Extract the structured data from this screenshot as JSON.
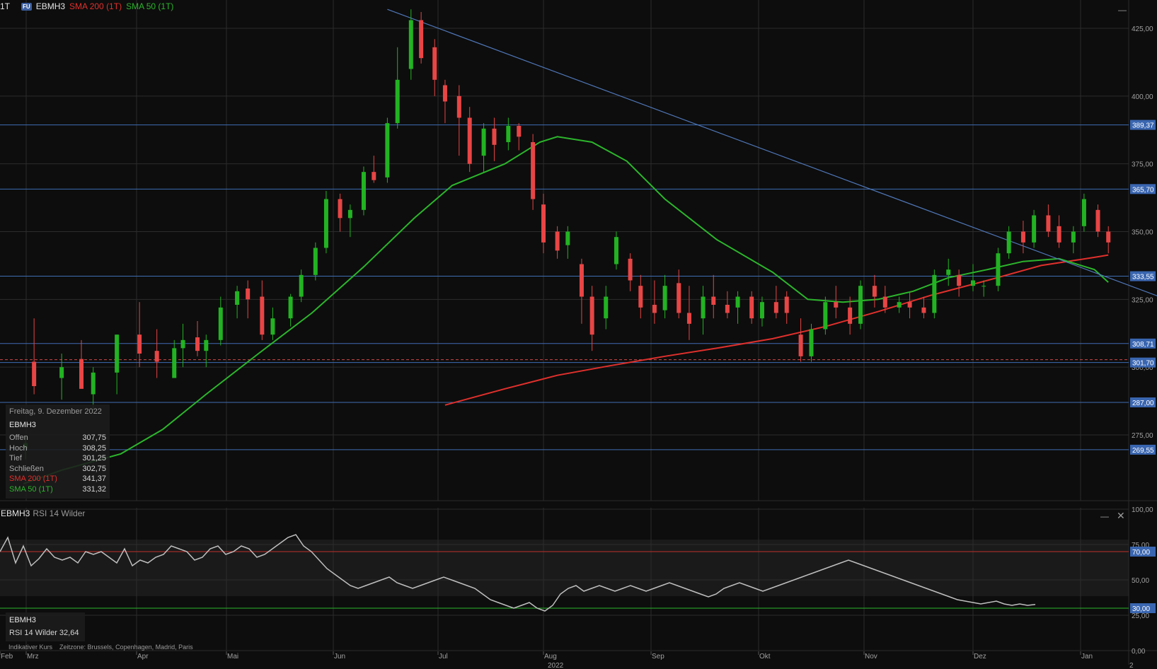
{
  "header": {
    "timeframe": "1T",
    "badge": "FU",
    "symbol": "EBMH3",
    "sma200_label": "SMA 200 (1T)",
    "sma50_label": "SMA 50 (1T)"
  },
  "colors": {
    "up": "#22b322",
    "down": "#e84545",
    "sma200": "#e0302c",
    "sma50": "#2cb52c",
    "trendline": "#4f77b8",
    "hline": "#3f6db3",
    "rsi": "#bfbfbf",
    "rsi_upper": "#c0302c",
    "rsi_lower": "#2cb52c"
  },
  "info_box": {
    "date": "Freitag, 9. Dezember 2022",
    "symbol": "EBMH3",
    "rows": [
      {
        "label": "Offen",
        "value": "307,75"
      },
      {
        "label": "Hoch",
        "value": "308,25"
      },
      {
        "label": "Tief",
        "value": "301,25"
      },
      {
        "label": "Schließen",
        "value": "302,75"
      },
      {
        "label": "SMA 200 (1T)",
        "value": "341,37"
      },
      {
        "label": "SMA 50 (1T)",
        "value": "331,32"
      }
    ]
  },
  "rsi_panel": {
    "symbol": "EBMH3",
    "name": "RSI 14 Wilder",
    "info_symbol": "EBMH3",
    "info_value": "RSI 14 Wilder 32,64"
  },
  "footer": {
    "note": "Indikativer Kurs",
    "timezone": "Zeitzone: Brussels, Copenhagen, Madrid, Paris"
  },
  "chart_data": [
    {
      "type": "candlestick",
      "price_axis": {
        "ylim": [
          255.0,
          432.0
        ],
        "ticks": [
          "425,00",
          "400,00",
          "375,00",
          "350,00",
          "325,00",
          "300,00",
          "275,00"
        ],
        "tick_values": [
          425,
          400,
          375,
          350,
          325,
          300,
          275
        ]
      },
      "x_axis": {
        "labels": [
          "Feb",
          "Mrz",
          "Apr",
          "Mai",
          "Jun",
          "Jul",
          "Aug",
          "Sep",
          "Okt",
          "Nov",
          "Dez",
          "Jan"
        ],
        "year_label": "2022",
        "year_label_right": "2"
      },
      "horizontal_levels": [
        {
          "value": 389.37,
          "label": "389,37"
        },
        {
          "value": 365.7,
          "label": "365,70"
        },
        {
          "value": 333.55,
          "label": "333,55"
        },
        {
          "value": 308.71,
          "label": "308,71"
        },
        {
          "value": 301.7,
          "label": "301,70"
        },
        {
          "value": 287.0,
          "label": "287,00"
        },
        {
          "value": 269.55,
          "label": "269,55"
        }
      ],
      "current_price_line": 302.75,
      "trendline": {
        "from": {
          "x": "2022-05-17",
          "y": 432.0
        },
        "to": {
          "x": "2022-12-30",
          "y": 323.0
        }
      },
      "sma200": {
        "label": "SMA 200 (1T)",
        "points": [
          {
            "x": "2022-06-03",
            "y": 286.0
          },
          {
            "x": "2022-06-20",
            "y": 292.0
          },
          {
            "x": "2022-07-05",
            "y": 297.0
          },
          {
            "x": "2022-07-20",
            "y": 300.5
          },
          {
            "x": "2022-08-05",
            "y": 304.0
          },
          {
            "x": "2022-08-20",
            "y": 307.0
          },
          {
            "x": "2022-09-05",
            "y": 310.5
          },
          {
            "x": "2022-09-20",
            "y": 315.0
          },
          {
            "x": "2022-10-05",
            "y": 320.5
          },
          {
            "x": "2022-10-20",
            "y": 326.5
          },
          {
            "x": "2022-11-05",
            "y": 332.0
          },
          {
            "x": "2022-11-20",
            "y": 337.5
          },
          {
            "x": "2022-12-05",
            "y": 340.5
          },
          {
            "x": "2022-12-09",
            "y": 341.37
          }
        ]
      },
      "sma50": {
        "label": "SMA 50 (1T)",
        "points": [
          {
            "x": "2022-01-28",
            "y": 257.0
          },
          {
            "x": "2022-02-10",
            "y": 262.0
          },
          {
            "x": "2022-02-25",
            "y": 268.0
          },
          {
            "x": "2022-03-10",
            "y": 277.0
          },
          {
            "x": "2022-03-25",
            "y": 290.0
          },
          {
            "x": "2022-04-10",
            "y": 305.0
          },
          {
            "x": "2022-04-25",
            "y": 320.0
          },
          {
            "x": "2022-05-10",
            "y": 337.0
          },
          {
            "x": "2022-05-25",
            "y": 355.0
          },
          {
            "x": "2022-06-05",
            "y": 367.0
          },
          {
            "x": "2022-06-20",
            "y": 375.0
          },
          {
            "x": "2022-06-30",
            "y": 383.0
          },
          {
            "x": "2022-07-05",
            "y": 385.0
          },
          {
            "x": "2022-07-15",
            "y": 383.0
          },
          {
            "x": "2022-07-25",
            "y": 376.0
          },
          {
            "x": "2022-08-05",
            "y": 362.0
          },
          {
            "x": "2022-08-20",
            "y": 347.0
          },
          {
            "x": "2022-09-05",
            "y": 335.0
          },
          {
            "x": "2022-09-15",
            "y": 325.0
          },
          {
            "x": "2022-09-25",
            "y": 324.0
          },
          {
            "x": "2022-10-05",
            "y": 325.0
          },
          {
            "x": "2022-10-15",
            "y": 328.0
          },
          {
            "x": "2022-10-25",
            "y": 333.0
          },
          {
            "x": "2022-11-05",
            "y": 336.0
          },
          {
            "x": "2022-11-15",
            "y": 339.0
          },
          {
            "x": "2022-11-25",
            "y": 340.0
          },
          {
            "x": "2022-12-05",
            "y": 336.0
          },
          {
            "x": "2022-12-09",
            "y": 331.32
          }
        ]
      },
      "candles": [
        {
          "x": "2022-01-31",
          "o": 270,
          "h": 275,
          "l": 266,
          "c": 272
        },
        {
          "x": "2022-02-03",
          "o": 302,
          "h": 318,
          "l": 290,
          "c": 293
        },
        {
          "x": "2022-02-10",
          "o": 296,
          "h": 305,
          "l": 288,
          "c": 300
        },
        {
          "x": "2022-02-15",
          "o": 303,
          "h": 310,
          "l": 296,
          "c": 292
        },
        {
          "x": "2022-02-18",
          "o": 290,
          "h": 300,
          "l": 284,
          "c": 298
        },
        {
          "x": "2022-02-24",
          "o": 298,
          "h": 312,
          "l": 290,
          "c": 312
        },
        {
          "x": "2022-03-02",
          "o": 312,
          "h": 324,
          "l": 300,
          "c": 305
        },
        {
          "x": "2022-03-08",
          "o": 306,
          "h": 314,
          "l": 296,
          "c": 302
        },
        {
          "x": "2022-03-14",
          "o": 296,
          "h": 310,
          "l": 296,
          "c": 307
        },
        {
          "x": "2022-03-17",
          "o": 307,
          "h": 316,
          "l": 300,
          "c": 310
        },
        {
          "x": "2022-03-22",
          "o": 311,
          "h": 317,
          "l": 304,
          "c": 306
        },
        {
          "x": "2022-03-25",
          "o": 306,
          "h": 312,
          "l": 300,
          "c": 310
        },
        {
          "x": "2022-03-30",
          "o": 310,
          "h": 326,
          "l": 308,
          "c": 322
        },
        {
          "x": "2022-04-04",
          "o": 323,
          "h": 330,
          "l": 318,
          "c": 328
        },
        {
          "x": "2022-04-07",
          "o": 329,
          "h": 332,
          "l": 318,
          "c": 325
        },
        {
          "x": "2022-04-11",
          "o": 326,
          "h": 332,
          "l": 310,
          "c": 312
        },
        {
          "x": "2022-04-14",
          "o": 312,
          "h": 322,
          "l": 310,
          "c": 318
        },
        {
          "x": "2022-04-19",
          "o": 318,
          "h": 327,
          "l": 315,
          "c": 326
        },
        {
          "x": "2022-04-22",
          "o": 326,
          "h": 336,
          "l": 324,
          "c": 334
        },
        {
          "x": "2022-04-26",
          "o": 334,
          "h": 346,
          "l": 332,
          "c": 344
        },
        {
          "x": "2022-04-29",
          "o": 344,
          "h": 365,
          "l": 342,
          "c": 362
        },
        {
          "x": "2022-05-03",
          "o": 362,
          "h": 364,
          "l": 350,
          "c": 355
        },
        {
          "x": "2022-05-06",
          "o": 355,
          "h": 360,
          "l": 348,
          "c": 358
        },
        {
          "x": "2022-05-10",
          "o": 358,
          "h": 374,
          "l": 356,
          "c": 372
        },
        {
          "x": "2022-05-13",
          "o": 372,
          "h": 378,
          "l": 368,
          "c": 369
        },
        {
          "x": "2022-05-17",
          "o": 370,
          "h": 392,
          "l": 368,
          "c": 390
        },
        {
          "x": "2022-05-20",
          "o": 390,
          "h": 418,
          "l": 388,
          "c": 406
        },
        {
          "x": "2022-05-24",
          "o": 410,
          "h": 432,
          "l": 406,
          "c": 428
        },
        {
          "x": "2022-05-27",
          "o": 428,
          "h": 431,
          "l": 412,
          "c": 414
        },
        {
          "x": "2022-05-31",
          "o": 418,
          "h": 421,
          "l": 400,
          "c": 406
        },
        {
          "x": "2022-06-03",
          "o": 404,
          "h": 406,
          "l": 390,
          "c": 398
        },
        {
          "x": "2022-06-07",
          "o": 400,
          "h": 404,
          "l": 378,
          "c": 392
        },
        {
          "x": "2022-06-10",
          "o": 392,
          "h": 396,
          "l": 372,
          "c": 375
        },
        {
          "x": "2022-06-14",
          "o": 378,
          "h": 390,
          "l": 372,
          "c": 388
        },
        {
          "x": "2022-06-17",
          "o": 388,
          "h": 392,
          "l": 376,
          "c": 382
        },
        {
          "x": "2022-06-21",
          "o": 383,
          "h": 392,
          "l": 380,
          "c": 389
        },
        {
          "x": "2022-06-24",
          "o": 389,
          "h": 390,
          "l": 380,
          "c": 385
        },
        {
          "x": "2022-06-28",
          "o": 383,
          "h": 386,
          "l": 358,
          "c": 362
        },
        {
          "x": "2022-07-01",
          "o": 360,
          "h": 364,
          "l": 342,
          "c": 346
        },
        {
          "x": "2022-07-05",
          "o": 350,
          "h": 352,
          "l": 340,
          "c": 343
        },
        {
          "x": "2022-07-08",
          "o": 345,
          "h": 352,
          "l": 340,
          "c": 350
        },
        {
          "x": "2022-07-12",
          "o": 338,
          "h": 340,
          "l": 316,
          "c": 326
        },
        {
          "x": "2022-07-15",
          "o": 326,
          "h": 330,
          "l": 306,
          "c": 312
        },
        {
          "x": "2022-07-19",
          "o": 318,
          "h": 330,
          "l": 314,
          "c": 326
        },
        {
          "x": "2022-07-22",
          "o": 338,
          "h": 350,
          "l": 336,
          "c": 348
        },
        {
          "x": "2022-07-26",
          "o": 340,
          "h": 342,
          "l": 328,
          "c": 332
        },
        {
          "x": "2022-07-29",
          "o": 330,
          "h": 334,
          "l": 318,
          "c": 322
        },
        {
          "x": "2022-08-02",
          "o": 323,
          "h": 332,
          "l": 316,
          "c": 320
        },
        {
          "x": "2022-08-05",
          "o": 321,
          "h": 334,
          "l": 318,
          "c": 330
        },
        {
          "x": "2022-08-09",
          "o": 331,
          "h": 336,
          "l": 318,
          "c": 320
        },
        {
          "x": "2022-08-12",
          "o": 320,
          "h": 330,
          "l": 310,
          "c": 316
        },
        {
          "x": "2022-08-16",
          "o": 318,
          "h": 330,
          "l": 312,
          "c": 326
        },
        {
          "x": "2022-08-19",
          "o": 326,
          "h": 334,
          "l": 318,
          "c": 323
        },
        {
          "x": "2022-08-23",
          "o": 323,
          "h": 328,
          "l": 318,
          "c": 320
        },
        {
          "x": "2022-08-26",
          "o": 322,
          "h": 328,
          "l": 316,
          "c": 326
        },
        {
          "x": "2022-08-30",
          "o": 326,
          "h": 328,
          "l": 316,
          "c": 318
        },
        {
          "x": "2022-09-02",
          "o": 318,
          "h": 326,
          "l": 315,
          "c": 324
        },
        {
          "x": "2022-09-06",
          "o": 324,
          "h": 330,
          "l": 318,
          "c": 320
        },
        {
          "x": "2022-09-09",
          "o": 326,
          "h": 328,
          "l": 316,
          "c": 320
        },
        {
          "x": "2022-09-13",
          "o": 312,
          "h": 318,
          "l": 302,
          "c": 304
        },
        {
          "x": "2022-09-16",
          "o": 304,
          "h": 316,
          "l": 302,
          "c": 314
        },
        {
          "x": "2022-09-20",
          "o": 314,
          "h": 326,
          "l": 312,
          "c": 324
        },
        {
          "x": "2022-09-23",
          "o": 324,
          "h": 330,
          "l": 318,
          "c": 322
        },
        {
          "x": "2022-09-27",
          "o": 322,
          "h": 326,
          "l": 312,
          "c": 316
        },
        {
          "x": "2022-09-30",
          "o": 316,
          "h": 332,
          "l": 314,
          "c": 330
        },
        {
          "x": "2022-10-04",
          "o": 330,
          "h": 334,
          "l": 322,
          "c": 326
        },
        {
          "x": "2022-10-07",
          "o": 326,
          "h": 330,
          "l": 320,
          "c": 322
        },
        {
          "x": "2022-10-11",
          "o": 322,
          "h": 326,
          "l": 320,
          "c": 324
        },
        {
          "x": "2022-10-14",
          "o": 324,
          "h": 328,
          "l": 318,
          "c": 322
        },
        {
          "x": "2022-10-18",
          "o": 322,
          "h": 326,
          "l": 318,
          "c": 320
        },
        {
          "x": "2022-10-21",
          "o": 320,
          "h": 336,
          "l": 318,
          "c": 334
        },
        {
          "x": "2022-10-25",
          "o": 334,
          "h": 340,
          "l": 330,
          "c": 336
        },
        {
          "x": "2022-10-28",
          "o": 334,
          "h": 336,
          "l": 326,
          "c": 330
        },
        {
          "x": "2022-11-01",
          "o": 330,
          "h": 338,
          "l": 328,
          "c": 332
        },
        {
          "x": "2022-11-04",
          "o": 330,
          "h": 332,
          "l": 326,
          "c": 330
        },
        {
          "x": "2022-11-08",
          "o": 330,
          "h": 344,
          "l": 328,
          "c": 342
        },
        {
          "x": "2022-11-11",
          "o": 342,
          "h": 352,
          "l": 340,
          "c": 350
        },
        {
          "x": "2022-11-15",
          "o": 350,
          "h": 354,
          "l": 342,
          "c": 346
        },
        {
          "x": "2022-11-18",
          "o": 346,
          "h": 358,
          "l": 344,
          "c": 356
        },
        {
          "x": "2022-11-22",
          "o": 356,
          "h": 360,
          "l": 348,
          "c": 350
        },
        {
          "x": "2022-11-25",
          "o": 352,
          "h": 356,
          "l": 344,
          "c": 346
        },
        {
          "x": "2022-11-29",
          "o": 346,
          "h": 352,
          "l": 342,
          "c": 350
        },
        {
          "x": "2022-12-02",
          "o": 352,
          "h": 364,
          "l": 350,
          "c": 362
        },
        {
          "x": "2022-12-06",
          "o": 358,
          "h": 360,
          "l": 348,
          "c": 350
        },
        {
          "x": "2022-12-09",
          "o": 350,
          "h": 352,
          "l": 342,
          "c": 346
        }
      ]
    },
    {
      "type": "line",
      "name": "RSI 14 Wilder",
      "ylim": [
        0,
        100
      ],
      "ticks": [
        "100,00",
        "75,00",
        "50,00",
        "25,00",
        "0,00"
      ],
      "upper_level": {
        "value": 70,
        "label": "70,00"
      },
      "lower_level": {
        "value": 30,
        "label": "30,00"
      },
      "values": [
        70,
        80,
        62,
        74,
        60,
        65,
        72,
        66,
        64,
        66,
        62,
        70,
        68,
        70,
        66,
        62,
        72,
        60,
        64,
        62,
        66,
        68,
        74,
        72,
        70,
        64,
        66,
        72,
        74,
        68,
        70,
        74,
        72,
        66,
        68,
        72,
        76,
        80,
        82,
        74,
        70,
        64,
        58,
        54,
        50,
        46,
        44,
        46,
        48,
        50,
        52,
        48,
        46,
        44,
        46,
        48,
        50,
        52,
        50,
        48,
        46,
        44,
        40,
        36,
        34,
        32,
        30,
        32,
        34,
        30,
        28,
        32,
        40,
        44,
        46,
        42,
        44,
        46,
        44,
        42,
        44,
        46,
        44,
        42,
        44,
        46,
        48,
        46,
        44,
        42,
        40,
        38,
        40,
        44,
        46,
        48,
        46,
        44,
        42,
        44,
        46,
        48,
        50,
        52,
        54,
        56,
        58,
        60,
        62,
        64,
        62,
        60,
        58,
        56,
        54,
        52,
        50,
        48,
        46,
        44,
        42,
        40,
        38,
        36,
        35,
        34,
        33,
        34,
        35,
        33,
        32,
        33,
        32,
        32.64
      ]
    }
  ]
}
